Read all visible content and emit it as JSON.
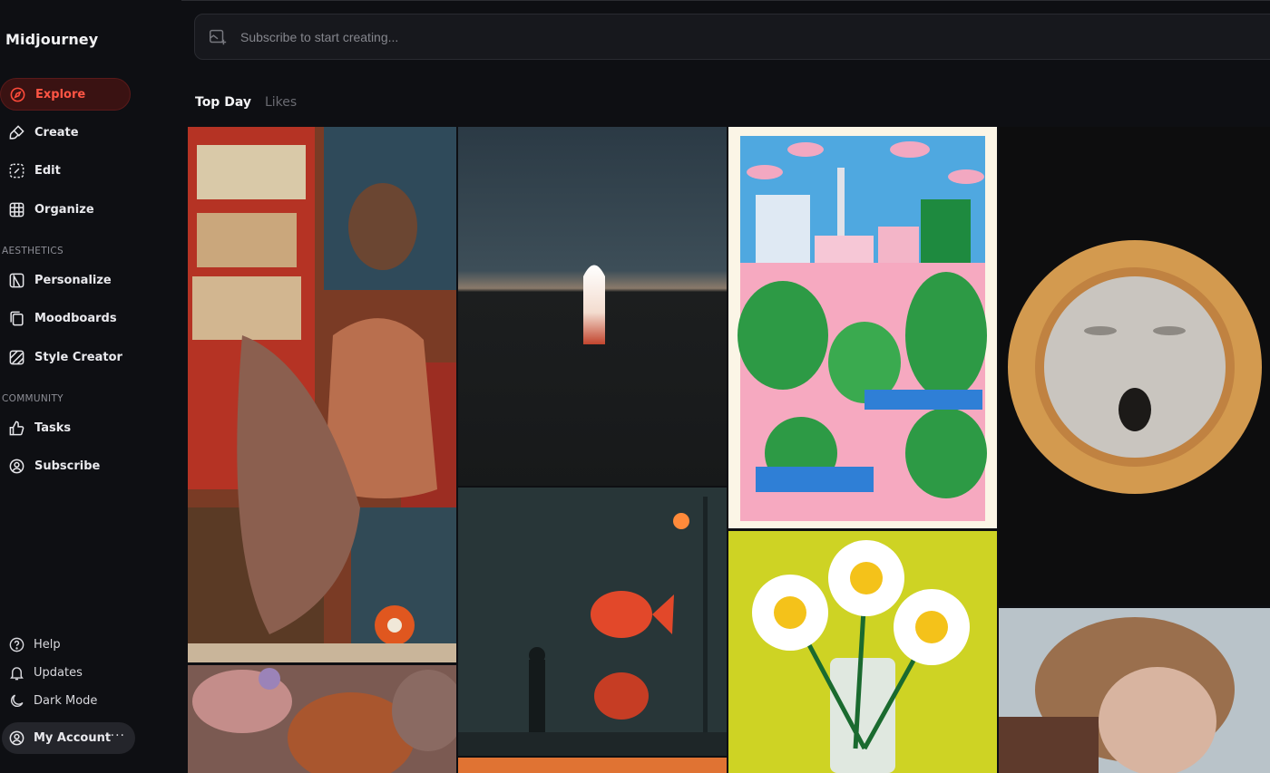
{
  "app": {
    "brand": "Midjourney"
  },
  "sidebar": {
    "main_items": [
      {
        "label": "Explore",
        "icon": "compass-icon",
        "active": true
      },
      {
        "label": "Create",
        "icon": "brush-icon"
      },
      {
        "label": "Edit",
        "icon": "edit-icon"
      },
      {
        "label": "Organize",
        "icon": "grid-icon"
      }
    ],
    "aesthetics_label": "AESTHETICS",
    "aesthetics_items": [
      {
        "label": "Personalize",
        "icon": "personalize-icon"
      },
      {
        "label": "Moodboards",
        "icon": "moodboards-icon"
      },
      {
        "label": "Style Creator",
        "icon": "style-creator-icon"
      }
    ],
    "community_label": "COMMUNITY",
    "community_items": [
      {
        "label": "Tasks",
        "icon": "thumbs-up-icon"
      },
      {
        "label": "Subscribe",
        "icon": "user-circle-icon"
      }
    ],
    "bottom_items": [
      {
        "label": "Help",
        "icon": "help-icon"
      },
      {
        "label": "Updates",
        "icon": "bell-icon"
      },
      {
        "label": "Dark Mode",
        "icon": "moon-icon"
      }
    ],
    "account": {
      "label": "My Account",
      "icon": "user-circle-icon",
      "more": "···"
    }
  },
  "search": {
    "placeholder": "Subscribe to start creating..."
  },
  "tabs": [
    {
      "label": "Top Day",
      "active": true
    },
    {
      "label": "Likes",
      "active": false
    }
  ],
  "accent_color": "#ff4b3a"
}
